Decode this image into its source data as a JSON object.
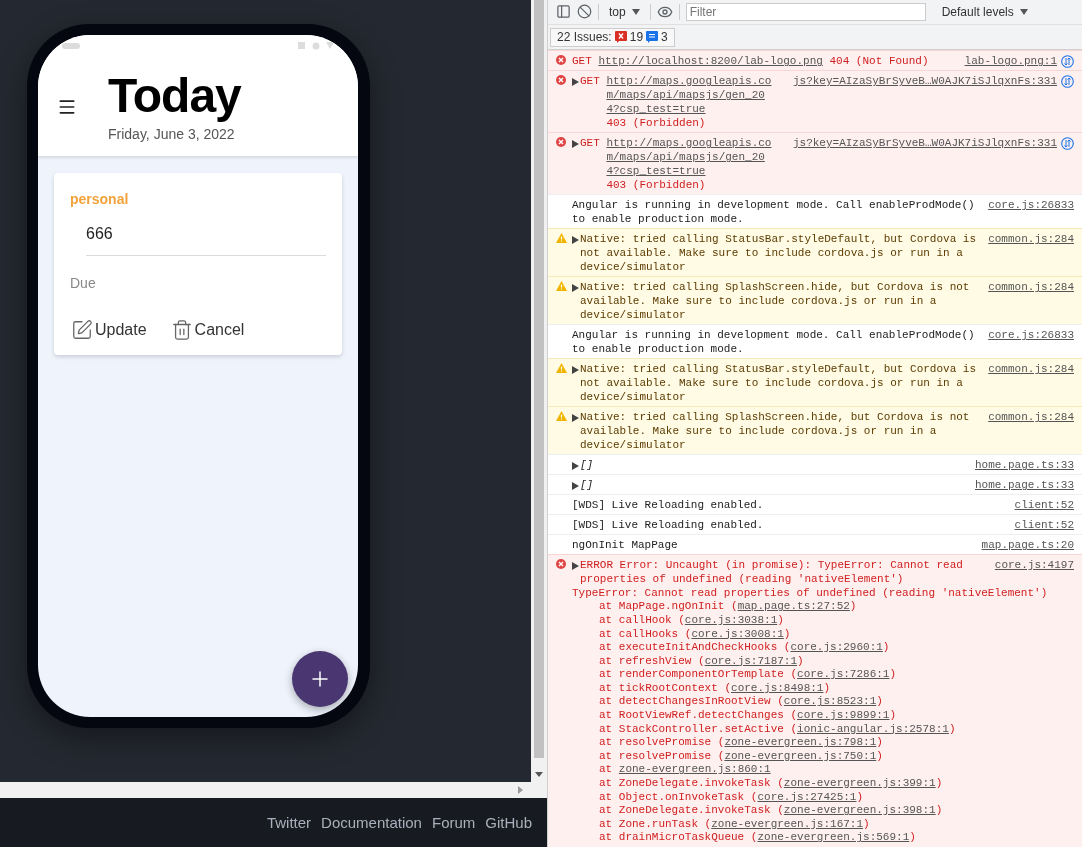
{
  "app": {
    "title": "Today",
    "date": "Friday, June 3, 2022",
    "task": {
      "category": "personal",
      "value": "666",
      "due_label": "Due",
      "actions": [
        {
          "kind": "update",
          "label": "Update"
        },
        {
          "kind": "cancel",
          "label": "Cancel"
        }
      ]
    }
  },
  "footer": {
    "links": [
      "Twitter",
      "Documentation",
      "Forum",
      "GitHub"
    ]
  },
  "devtools": {
    "toolbar": {
      "context": "top",
      "filter_placeholder": "Filter",
      "levels": "Default levels"
    },
    "issues": {
      "label": "22 Issues:",
      "errors": "19",
      "infos": "3"
    },
    "messages": [
      {
        "kind": "error",
        "expandable": false,
        "network": true,
        "method": "GET",
        "url": "http://localhost:8200/lab-logo.png",
        "status": "404 (Not Found)",
        "source": "lab-logo.png:1"
      },
      {
        "kind": "error",
        "expandable": true,
        "network": true,
        "method": "GET",
        "url": "http://maps.googleapis.com/maps/api/mapsjs/gen_204?csp_test=true",
        "status": "403 (Forbidden)",
        "source": "js?key=AIzaSyBrSyveB…W0AJK7iSJlqxnFs:331"
      },
      {
        "kind": "error",
        "expandable": true,
        "network": true,
        "method": "GET",
        "url": "http://maps.googleapis.com/maps/api/mapsjs/gen_204?csp_test=true",
        "status": "403 (Forbidden)",
        "source": "js?key=AIzaSyBrSyveB…W0AJK7iSJlqxnFs:331"
      },
      {
        "kind": "info",
        "expandable": false,
        "network": false,
        "text": "Angular is running in development mode. Call enableProdMode() to enable production mode.",
        "source": "core.js:26833"
      },
      {
        "kind": "warning",
        "expandable": true,
        "network": false,
        "text": "Native: tried calling StatusBar.styleDefault, but Cordova is not available. Make sure to include cordova.js or run in a device/simulator",
        "source": "common.js:284"
      },
      {
        "kind": "warning",
        "expandable": true,
        "network": false,
        "text": "Native: tried calling SplashScreen.hide, but Cordova is not available. Make sure to include cordova.js or run in a device/simulator",
        "source": "common.js:284"
      },
      {
        "kind": "info",
        "expandable": false,
        "network": false,
        "text": "Angular is running in development mode. Call enableProdMode() to enable production mode.",
        "source": "core.js:26833"
      },
      {
        "kind": "warning",
        "expandable": true,
        "network": false,
        "text": "Native: tried calling StatusBar.styleDefault, but Cordova is not available. Make sure to include cordova.js or run in a device/simulator",
        "source": "common.js:284"
      },
      {
        "kind": "warning",
        "expandable": true,
        "network": false,
        "text": "Native: tried calling SplashScreen.hide, but Cordova is not available. Make sure to include cordova.js or run in a device/simulator",
        "source": "common.js:284"
      },
      {
        "kind": "info",
        "expandable": true,
        "network": false,
        "text": "[]",
        "italic": true,
        "source": "home.page.ts:33"
      },
      {
        "kind": "info",
        "expandable": true,
        "network": false,
        "text": "[]",
        "italic": true,
        "source": "home.page.ts:33"
      },
      {
        "kind": "info",
        "expandable": false,
        "network": false,
        "text": "[WDS] Live Reloading enabled.",
        "source": "client:52"
      },
      {
        "kind": "info",
        "expandable": false,
        "network": false,
        "text": "[WDS] Live Reloading enabled.",
        "source": "client:52"
      },
      {
        "kind": "info",
        "expandable": false,
        "network": false,
        "text": "ngOnInit MapPage",
        "source": "map.page.ts:20"
      },
      {
        "kind": "error",
        "expandable": true,
        "network": false,
        "text": "ERROR Error: Uncaught (in promise): TypeError: Cannot read properties of undefined (reading 'nativeElement')",
        "source": "core.js:4197",
        "detail": "TypeError: Cannot read properties of undefined (reading 'nativeElement')",
        "stack": [
          {
            "text": "at MapPage.ngOnInit (",
            "link": "map.page.ts:27:52",
            "end": ")"
          },
          {
            "text": "at callHook (",
            "link": "core.js:3038:1",
            "end": ")"
          },
          {
            "text": "at callHooks (",
            "link": "core.js:3008:1",
            "end": ")"
          },
          {
            "text": "at executeInitAndCheckHooks (",
            "link": "core.js:2960:1",
            "end": ")"
          },
          {
            "text": "at refreshView (",
            "link": "core.js:7187:1",
            "end": ")"
          },
          {
            "text": "at renderComponentOrTemplate (",
            "link": "core.js:7286:1",
            "end": ")"
          },
          {
            "text": "at tickRootContext (",
            "link": "core.js:8498:1",
            "end": ")"
          },
          {
            "text": "at detectChangesInRootView (",
            "link": "core.js:8523:1",
            "end": ")"
          },
          {
            "text": "at RootViewRef.detectChanges (",
            "link": "core.js:9899:1",
            "end": ")"
          },
          {
            "text": "at StackController.setActive (",
            "link": "ionic-angular.js:2578:1",
            "end": ")"
          },
          {
            "text": "at resolvePromise (",
            "link": "zone-evergreen.js:798:1",
            "end": ")"
          },
          {
            "text": "at resolvePromise (",
            "link": "zone-evergreen.js:750:1",
            "end": ")"
          },
          {
            "text": "at ",
            "link": "zone-evergreen.js:860:1"
          },
          {
            "text": "at ZoneDelegate.invokeTask (",
            "link": "zone-evergreen.js:399:1",
            "end": ")"
          },
          {
            "text": "at Object.onInvokeTask (",
            "link": "core.js:27425:1",
            "end": ")"
          },
          {
            "text": "at ZoneDelegate.invokeTask (",
            "link": "zone-evergreen.js:398:1",
            "end": ")"
          },
          {
            "text": "at Zone.runTask (",
            "link": "zone-evergreen.js:167:1",
            "end": ")"
          },
          {
            "text": "at drainMicroTaskQueue (",
            "link": "zone-evergreen.js:569:1",
            "end": ")"
          }
        ]
      }
    ]
  }
}
